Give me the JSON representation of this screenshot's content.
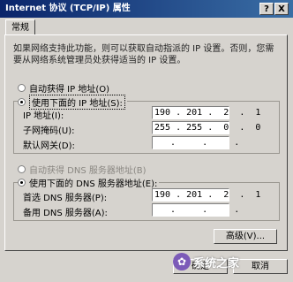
{
  "window": {
    "title": "Internet 协议 (TCP/IP) 属性",
    "help_button": "?",
    "close_button": "X"
  },
  "tabs": [
    {
      "label": "常规"
    }
  ],
  "description": "如果网络支持此功能，则可以获取自动指派的 IP 设置。否则，您需要从网络系统管理员处获得适当的 IP 设置。",
  "ip_options": {
    "auto_label": "自动获得 IP 地址(O)",
    "manual_label": "使用下面的 IP 地址(S):",
    "selected": "manual"
  },
  "ip_fields": [
    {
      "label": "IP 地址(I):",
      "value": "190 . 201 .  2  .  1"
    },
    {
      "label": "子网掩码(U):",
      "value": "255 . 255 .  0  .  0"
    },
    {
      "label": "默认网关(D):",
      "value": "   .     .     .   "
    }
  ],
  "dns_options": {
    "auto_label": "自动获得 DNS 服务器地址(B)",
    "manual_label": "使用下面的 DNS 服务器地址(E):",
    "selected": "manual"
  },
  "dns_fields": [
    {
      "label": "首选 DNS 服务器(P):",
      "value": "190 . 201 .  2  .  1"
    },
    {
      "label": "备用 DNS 服务器(A):",
      "value": "   .     .     .   "
    }
  ],
  "buttons": {
    "advanced": "高级(V)...",
    "ok": "确定",
    "cancel": "取消"
  },
  "watermark": {
    "text": "系统之家"
  }
}
